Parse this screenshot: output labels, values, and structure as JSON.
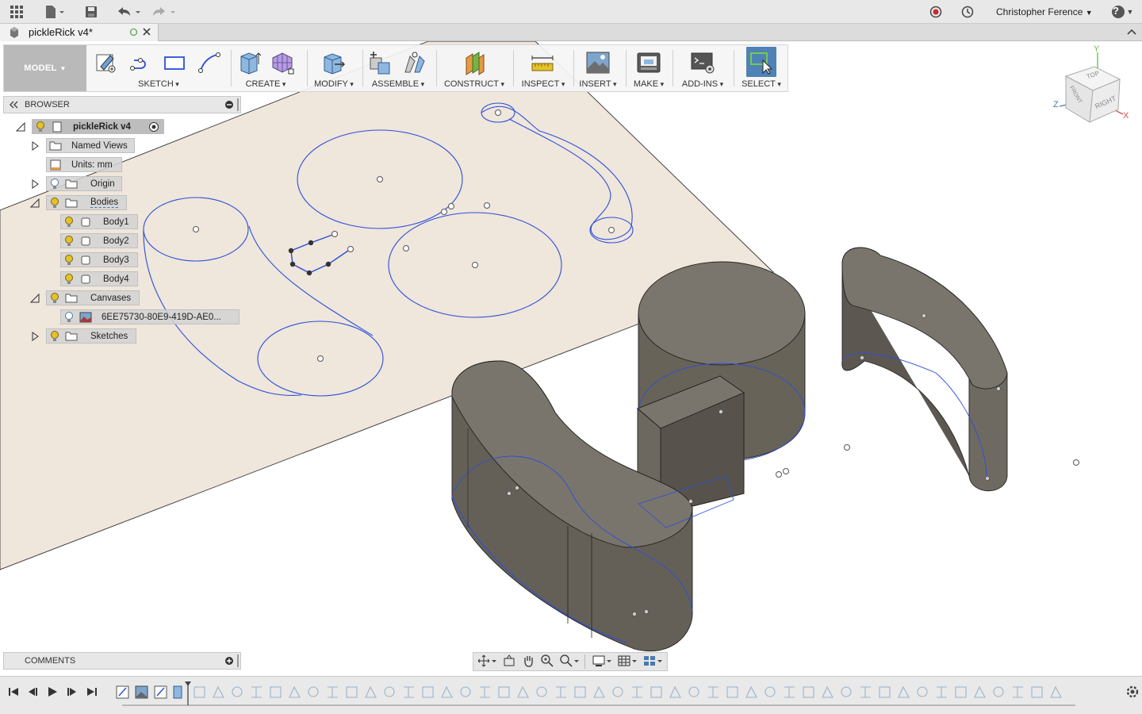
{
  "app": {
    "user_name": "Christopher Ference",
    "help_label": "?"
  },
  "document": {
    "tab_title": "pickleRick v4*"
  },
  "toolbar": {
    "workspace": "MODEL",
    "groups": [
      {
        "label": "SKETCH"
      },
      {
        "label": "CREATE"
      },
      {
        "label": "MODIFY"
      },
      {
        "label": "ASSEMBLE"
      },
      {
        "label": "CONSTRUCT"
      },
      {
        "label": "INSPECT"
      },
      {
        "label": "INSERT"
      },
      {
        "label": "MAKE"
      },
      {
        "label": "ADD-INS"
      },
      {
        "label": "SELECT"
      }
    ]
  },
  "browser": {
    "title": "BROWSER",
    "items": [
      {
        "label": "pickleRick v4"
      },
      {
        "label": "Named Views"
      },
      {
        "label": "Units: mm"
      },
      {
        "label": "Origin"
      },
      {
        "label": "Bodies"
      },
      {
        "label": "Body1"
      },
      {
        "label": "Body2"
      },
      {
        "label": "Body3"
      },
      {
        "label": "Body4"
      },
      {
        "label": "Canvases"
      },
      {
        "label": "6EE75730-80E9-419D-AE0..."
      },
      {
        "label": "Sketches"
      }
    ]
  },
  "viewcube": {
    "top": "TOP",
    "front": "FRONT",
    "right": "RIGHT",
    "axis_x": "X",
    "axis_y": "Y",
    "axis_z": "Z"
  },
  "comments": {
    "title": "COMMENTS"
  },
  "colors": {
    "sketch_blue": "#2b4fd6",
    "body_fill": "#6f6a61",
    "canvas_plane": "#efe6dc",
    "select_active": "#4f82b5",
    "bulb_yellow": "#e6c22a"
  }
}
